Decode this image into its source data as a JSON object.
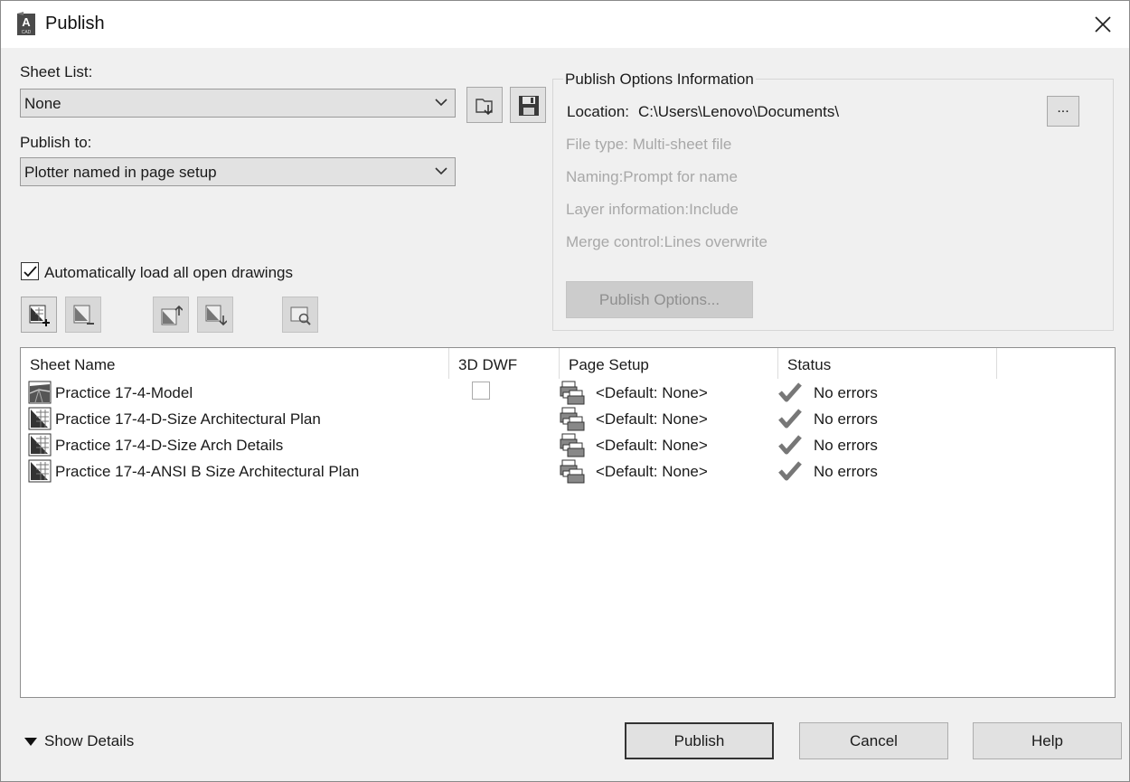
{
  "window": {
    "title": "Publish",
    "close_glyph": "✕"
  },
  "sheet_list": {
    "label": "Sheet List:",
    "value": "None"
  },
  "publish_to": {
    "label": "Publish to:",
    "value": "Plotter named in page setup"
  },
  "auto_load": {
    "label": "Automatically load all open drawings",
    "checked": true
  },
  "options_info": {
    "legend": "Publish Options Information",
    "location_label": "Location:",
    "location_value": "C:\\Users\\Lenovo\\Documents\\",
    "browse_label": "...",
    "file_type": "File type: Multi-sheet file",
    "naming": "Naming:Prompt for name",
    "layer_info": "Layer information:Include",
    "merge_control": "Merge control:Lines overwrite",
    "publish_options_button": "Publish Options..."
  },
  "toolbar_icons": [
    "add-sheets-icon",
    "remove-sheets-icon",
    "move-up-icon",
    "move-down-icon",
    "preview-icon"
  ],
  "table": {
    "columns": [
      "Sheet Name",
      "3D DWF",
      "Page Setup",
      "Status"
    ],
    "rows": [
      {
        "name": "Practice 17-4-Model",
        "icon": "model-sheet-icon",
        "dwf_checkbox": true,
        "page_setup": "<Default: None>",
        "status": "No errors"
      },
      {
        "name": "Practice 17-4-D-Size Architectural Plan",
        "icon": "layout-sheet-icon",
        "dwf_checkbox": false,
        "page_setup": "<Default: None>",
        "status": "No errors"
      },
      {
        "name": "Practice 17-4-D-Size Arch Details",
        "icon": "layout-sheet-icon",
        "dwf_checkbox": false,
        "page_setup": "<Default: None>",
        "status": "No errors"
      },
      {
        "name": "Practice 17-4-ANSI B Size Architectural Plan",
        "icon": "layout-sheet-icon",
        "dwf_checkbox": false,
        "page_setup": "<Default: None>",
        "status": "No errors"
      }
    ]
  },
  "footer": {
    "show_details": "Show Details",
    "publish": "Publish",
    "cancel": "Cancel",
    "help": "Help"
  }
}
